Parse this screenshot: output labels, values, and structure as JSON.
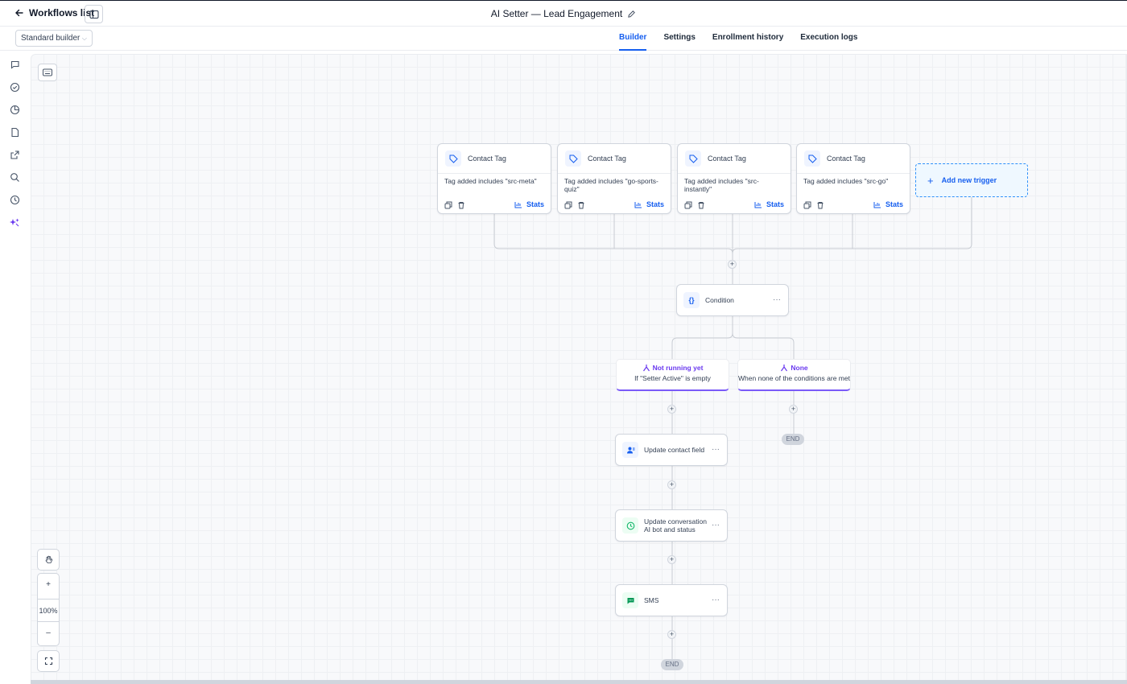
{
  "header": {
    "back_label": "Workflows list",
    "title": "AI Setter — Lead Engagement"
  },
  "toolbar": {
    "builder_mode": "Standard builder",
    "tabs": [
      {
        "label": "Builder",
        "active": true
      },
      {
        "label": "Settings",
        "active": false
      },
      {
        "label": "Enrollment history",
        "active": false
      },
      {
        "label": "Execution logs",
        "active": false
      }
    ]
  },
  "rail": {
    "icons": [
      "chat-icon",
      "check-circle-icon",
      "pie-chart-icon",
      "document-icon",
      "external-link-icon",
      "search-icon",
      "history-icon",
      "ai-sparkle-icon"
    ]
  },
  "triggers": [
    {
      "type": "Contact Tag",
      "desc": "Tag added includes \"src-meta\"",
      "stats": "Stats"
    },
    {
      "type": "Contact Tag",
      "desc": "Tag added includes \"go-sports-quiz\"",
      "stats": "Stats"
    },
    {
      "type": "Contact Tag",
      "desc": "Tag added includes \"src-instantly\"",
      "stats": "Stats"
    },
    {
      "type": "Contact Tag",
      "desc": "Tag added includes \"src-go\"",
      "stats": "Stats"
    }
  ],
  "add_trigger_label": "Add new trigger",
  "condition": {
    "label": "Condition",
    "more": "···"
  },
  "branches": [
    {
      "title": "Not running yet",
      "desc": "If \"Setter Active\" is empty"
    },
    {
      "title": "None",
      "desc": "When none of the conditions are met"
    }
  ],
  "actions": [
    {
      "label": "Update contact field",
      "icon": "user-edit-icon",
      "color": "#155eef"
    },
    {
      "label": "Update conversation AI bot and status",
      "icon": "clock-icon",
      "color": "#12b76a"
    },
    {
      "label": "SMS",
      "icon": "sms-icon",
      "color": "#039855"
    }
  ],
  "end_label": "END",
  "zoom": {
    "level": "100%",
    "plus": "+",
    "minus": "–"
  },
  "colors": {
    "accent": "#155eef",
    "branch": "#6938ef",
    "line": "#c8ccd3"
  }
}
